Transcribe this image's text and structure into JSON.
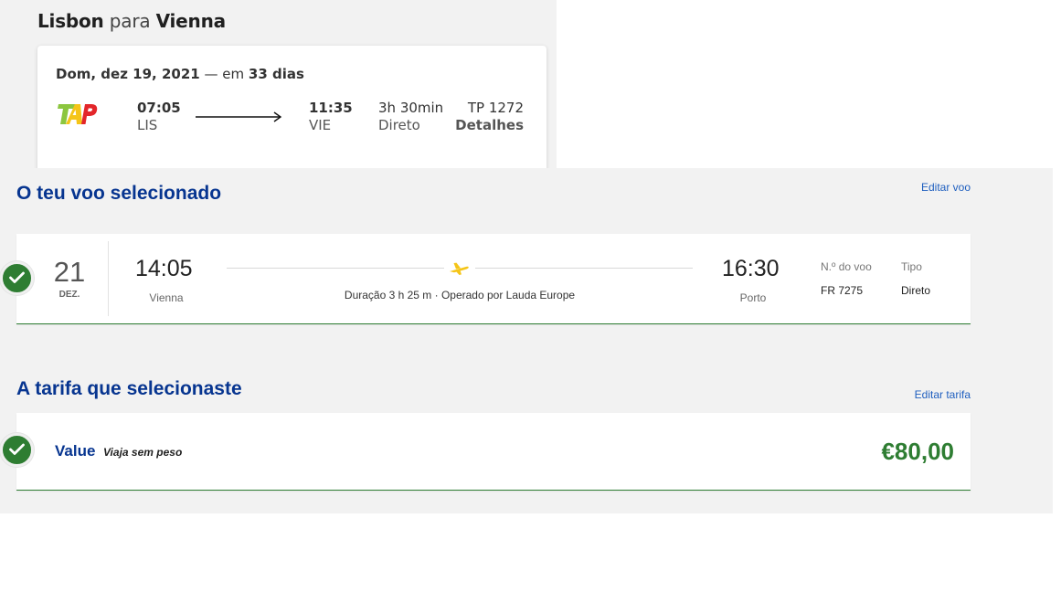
{
  "tap": {
    "origin_city": "Lisbon",
    "connector": "para",
    "destination_city": "Vienna",
    "date": "Dom, dez 19, 2021",
    "relative_sep": "— em",
    "relative_days": "33 dias",
    "depart_time": "07:05",
    "depart_code": "LIS",
    "arrive_time": "11:35",
    "arrive_code": "VIE",
    "duration": "3h 30min",
    "stops": "Direto",
    "flight_number": "TP 1272",
    "details_link": "Detalhes",
    "logo": "tap-logo-icon"
  },
  "selected_flight": {
    "title": "O teu voo selecionado",
    "edit_link": "Editar voo",
    "day": "21",
    "month": "DEZ.",
    "depart_time": "14:05",
    "depart_city": "Vienna",
    "arrive_time": "16:30",
    "arrive_city": "Porto",
    "duration_info": "Duração 3 h 25 m · Operado por Lauda Europe",
    "flight_no_label": "N.º do voo",
    "flight_no": "FR 7275",
    "type_label": "Tipo",
    "type": "Direto",
    "status_icon": "checkmark-icon",
    "plane_icon": "airplane-icon"
  },
  "fare": {
    "title": "A tarifa que selecionaste",
    "edit_link": "Editar tarifa",
    "name": "Value",
    "subtitle": "Viaja sem peso",
    "price": "€80,00"
  },
  "colors": {
    "navy": "#073590",
    "green": "#2e7d32",
    "link": "#1f5fbf",
    "panel_bg": "#f2f2f2",
    "plane_yellow": "#f5c518"
  }
}
